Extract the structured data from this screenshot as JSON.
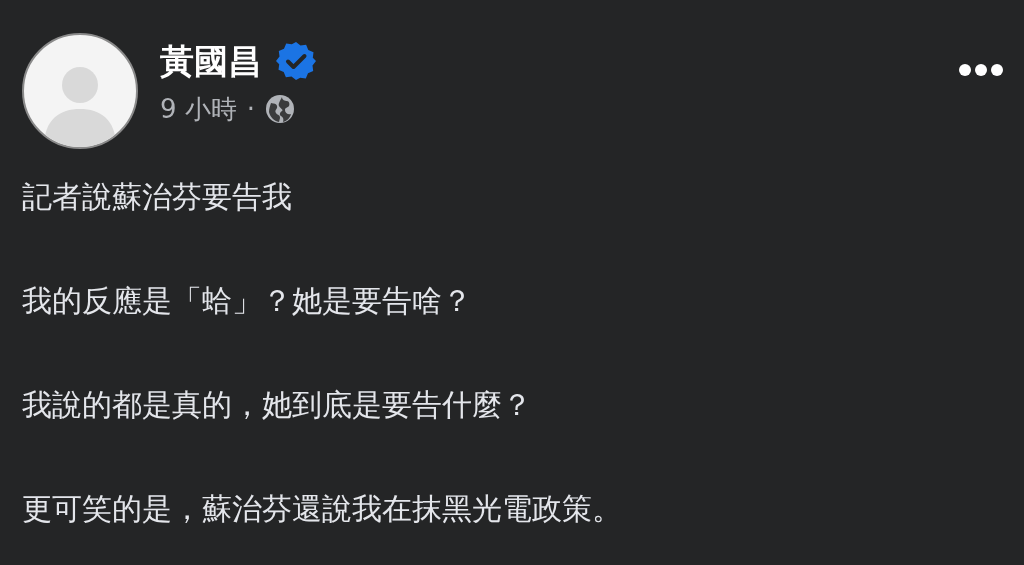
{
  "post": {
    "author": "黃國昌",
    "time": "9 小時",
    "separator": "·",
    "paragraphs": [
      "記者說蘇治芬要告我",
      "我的反應是「蛤」？她是要告啥？",
      "我說的都是真的，她到底是要告什麼？",
      "更可笑的是，蘇治芬還說我在抹黑光電政策。"
    ]
  }
}
